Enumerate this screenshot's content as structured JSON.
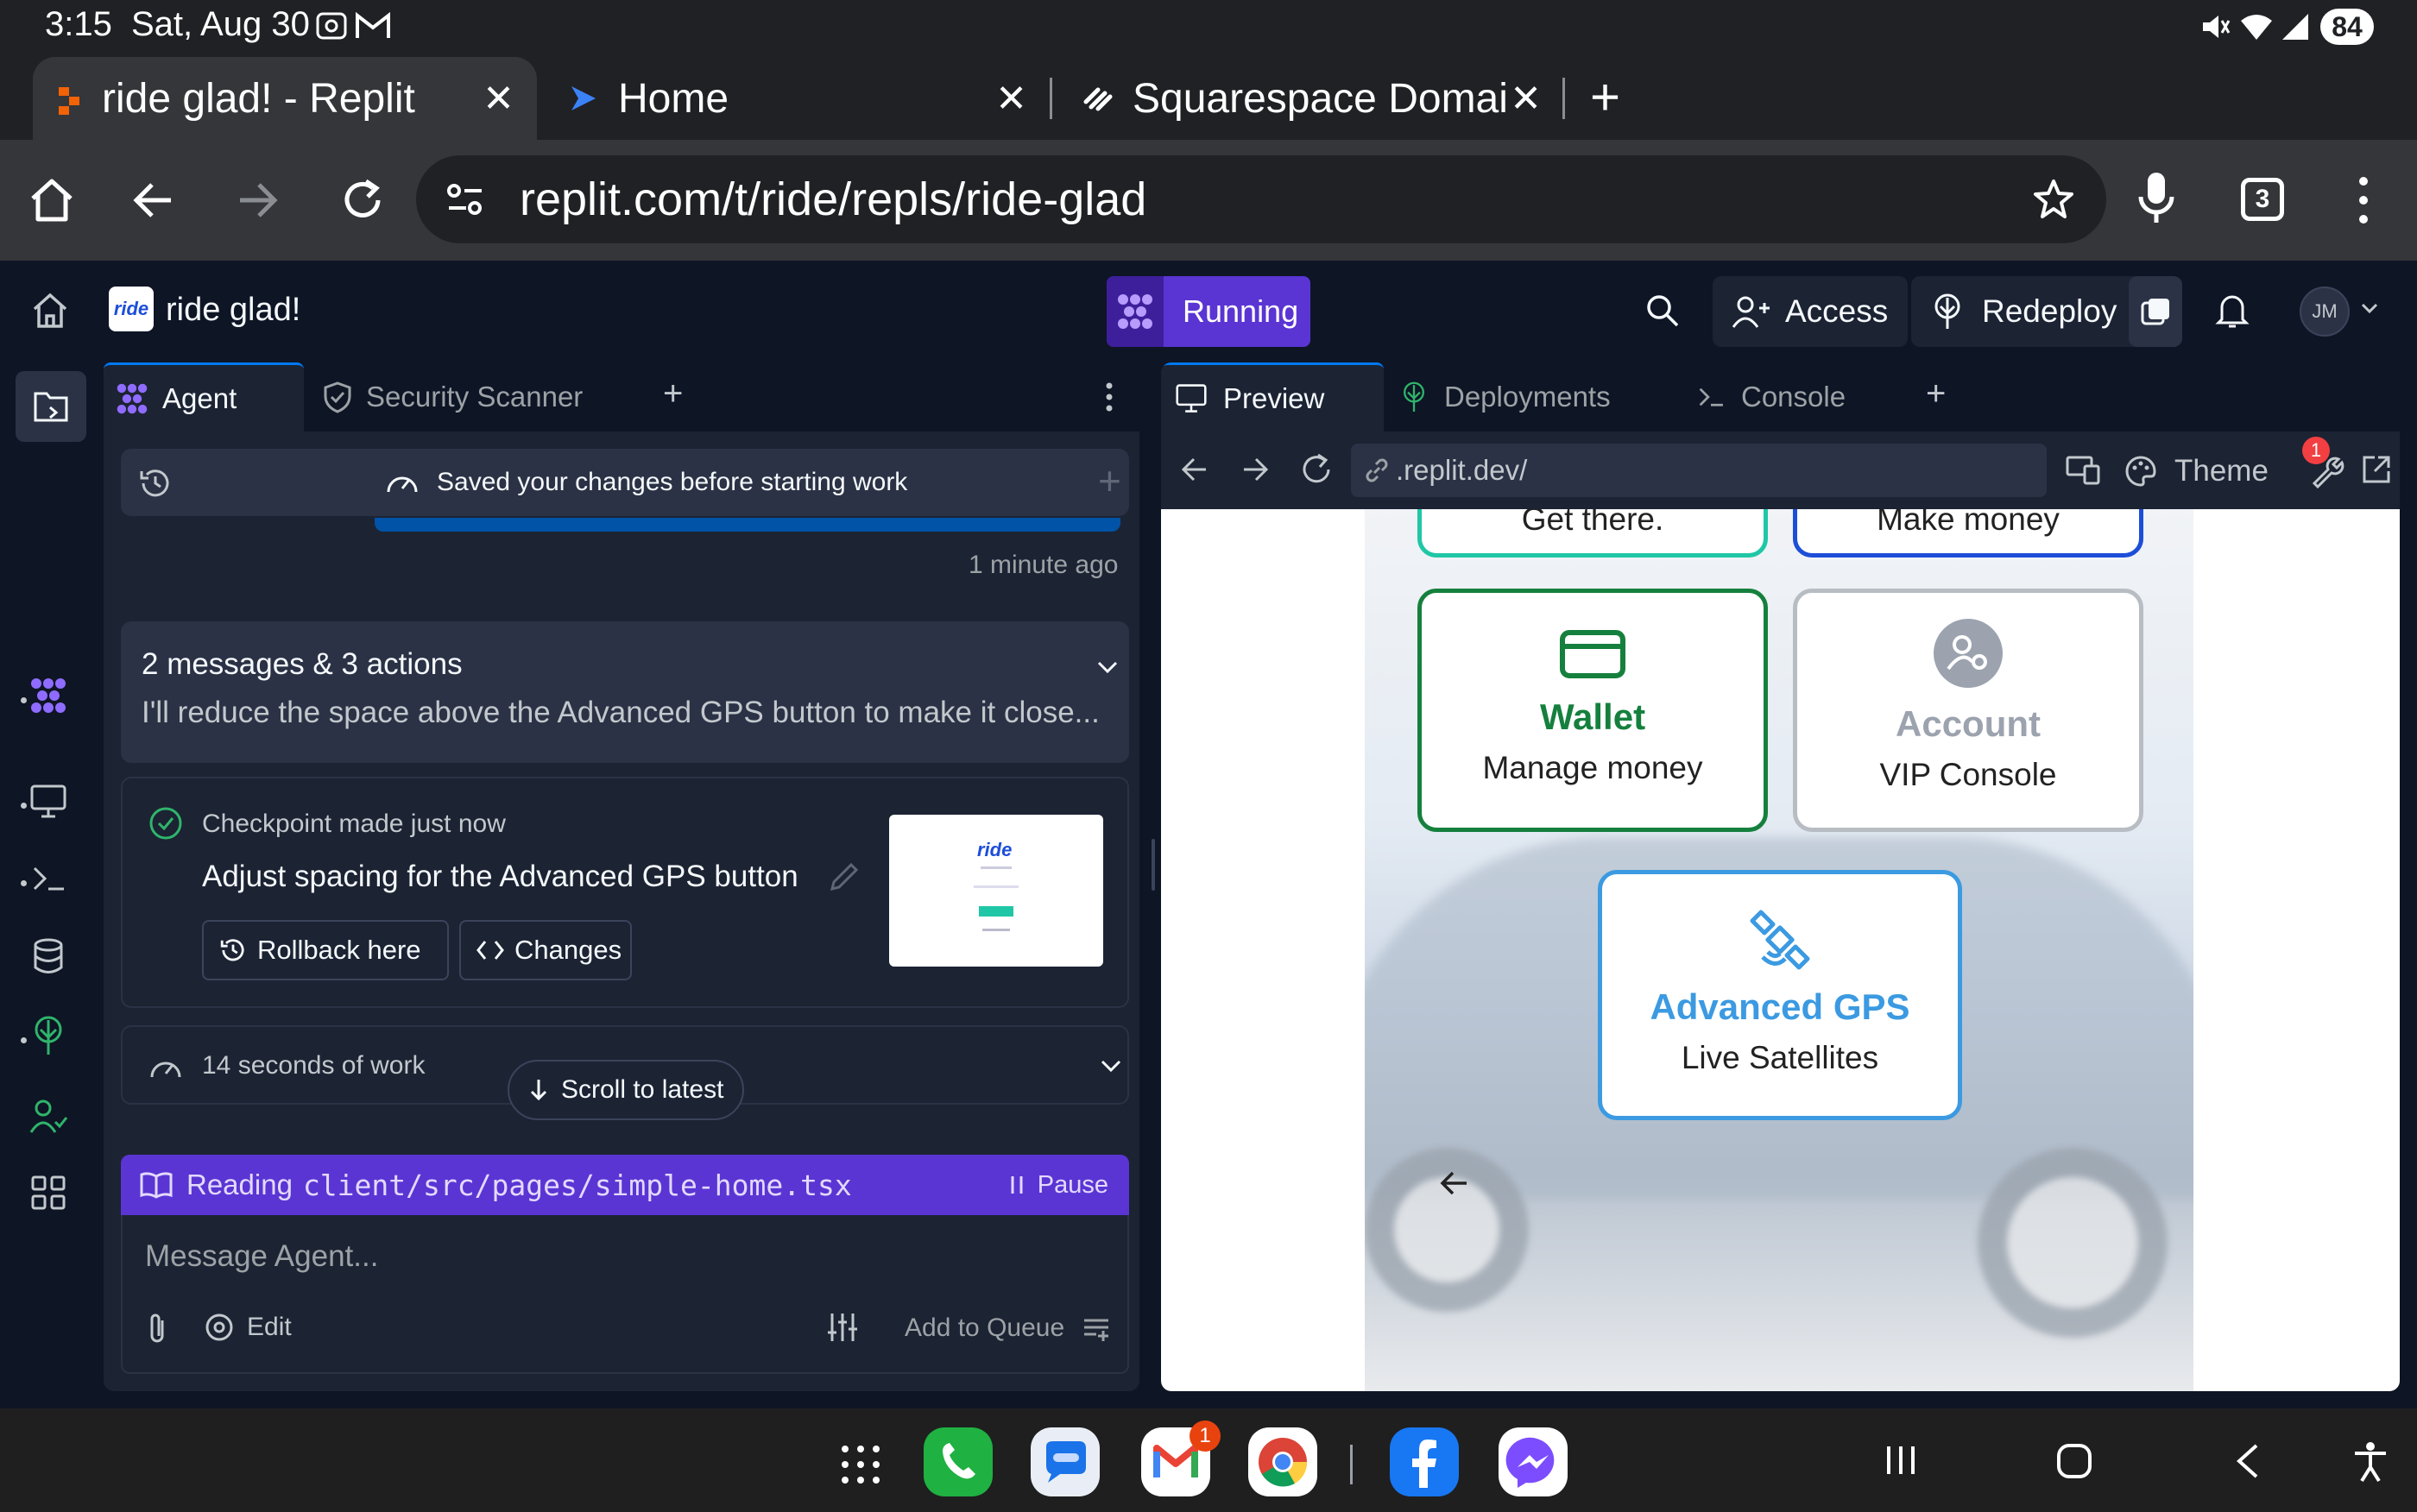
{
  "status_bar": {
    "time": "3:15",
    "date": "Sat, Aug 30",
    "battery": "84"
  },
  "browser": {
    "tabs": [
      {
        "title": "ride glad! - Replit",
        "active": true
      },
      {
        "title": "Home",
        "active": false
      },
      {
        "title": "Squarespace Domai",
        "active": false
      }
    ],
    "url": "replit.com/t/ride/repls/ride-glad",
    "tab_count": "3"
  },
  "replit": {
    "project_name": "ride glad!",
    "logo_text": "ride",
    "run_status": "Running",
    "access_label": "Access",
    "redeploy_label": "Redeploy",
    "avatar_initials": "JM",
    "left_tabs": [
      "Agent",
      "Security Scanner"
    ],
    "agent": {
      "saved_notice": "Saved your changes before starting work",
      "time_ago": "1 minute ago",
      "summary_title": "2 messages & 3 actions",
      "summary_text": "I'll reduce the space above the Advanced GPS button to make it close...",
      "checkpoint_label": "Checkpoint made just now",
      "checkpoint_title": "Adjust spacing for the Advanced GPS button",
      "rollback_label": "Rollback here",
      "changes_label": "Changes",
      "work_time": "14 seconds of work",
      "scroll_latest": "Scroll to latest",
      "reading_prefix": "Reading",
      "reading_file": "client/src/pages/simple-home.tsx",
      "pause_label": "Pause",
      "message_placeholder": "Message Agent...",
      "edit_label": "Edit",
      "queue_label": "Add to Queue"
    },
    "right_tabs": [
      "Preview",
      "Deployments",
      "Console"
    ],
    "preview": {
      "url": ".replit.dev/",
      "theme_label": "Theme",
      "notification_badge": "1",
      "tiles": [
        {
          "title": "",
          "subtitle": "Get there.",
          "color": "#1fc7a6"
        },
        {
          "title": "",
          "subtitle": "Make money",
          "color": "#1d4ed8"
        },
        {
          "title": "Wallet",
          "subtitle": "Manage money",
          "color": "#15803d"
        },
        {
          "title": "Account",
          "subtitle": "VIP Console",
          "color": "#9ca3af"
        },
        {
          "title": "Advanced GPS",
          "subtitle": "Live Satellites",
          "color": "#3b9ae1"
        }
      ]
    }
  },
  "android": {
    "gmail_badge": "1"
  }
}
